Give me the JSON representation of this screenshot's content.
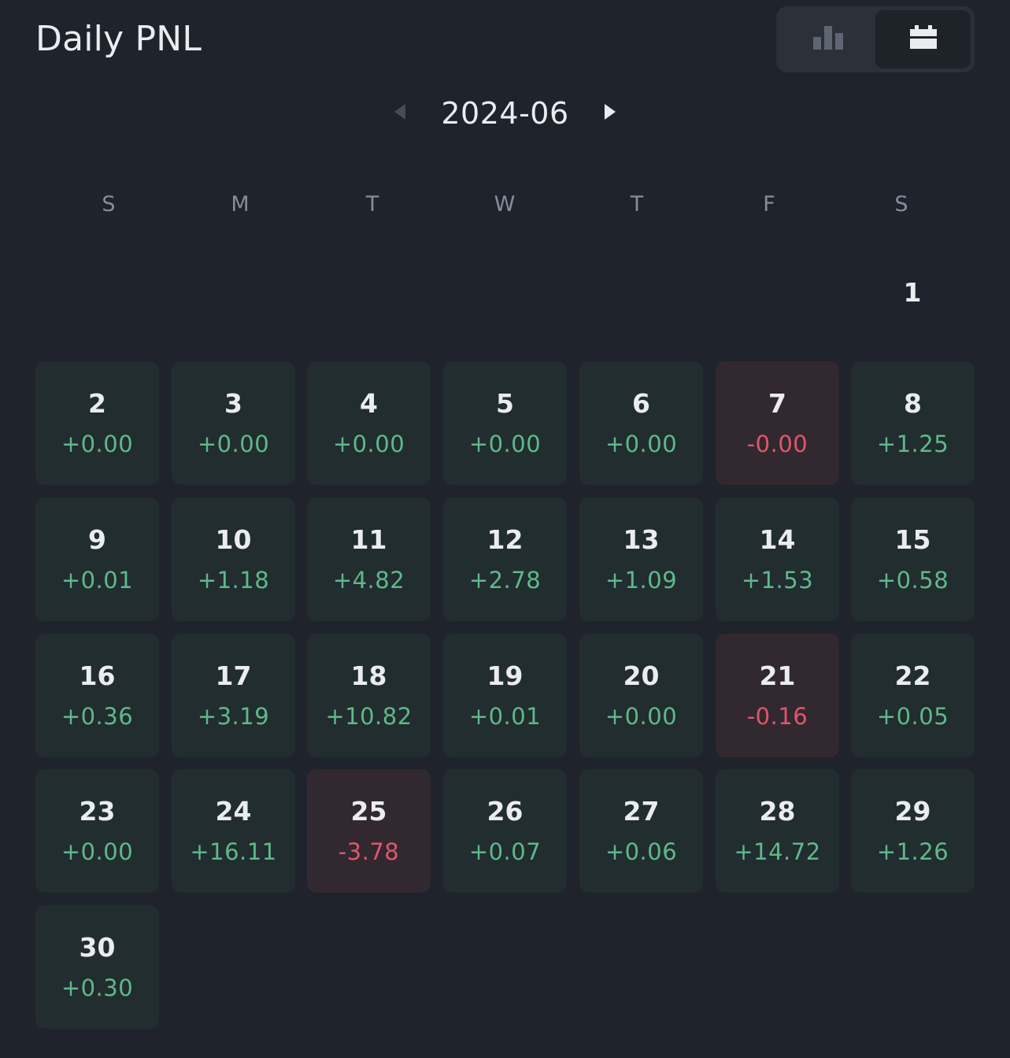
{
  "header": {
    "title": "Daily PNL"
  },
  "view_toggle": {
    "options": [
      {
        "icon": "bar-chart-icon",
        "active": false
      },
      {
        "icon": "calendar-icon",
        "active": true
      }
    ]
  },
  "month_nav": {
    "label": "2024-06",
    "prev_icon": "caret-left-icon",
    "next_icon": "caret-right-icon"
  },
  "weekdays": [
    "S",
    "M",
    "T",
    "W",
    "T",
    "F",
    "S"
  ],
  "first_day": "1",
  "colors": {
    "positive": "#5fb88a",
    "negative": "#e0566a",
    "background": "#1f232b"
  },
  "days": [
    {
      "day": "2",
      "pnl": "+0.00",
      "negative": false
    },
    {
      "day": "3",
      "pnl": "+0.00",
      "negative": false
    },
    {
      "day": "4",
      "pnl": "+0.00",
      "negative": false
    },
    {
      "day": "5",
      "pnl": "+0.00",
      "negative": false
    },
    {
      "day": "6",
      "pnl": "+0.00",
      "negative": false
    },
    {
      "day": "7",
      "pnl": "-0.00",
      "negative": true
    },
    {
      "day": "8",
      "pnl": "+1.25",
      "negative": false
    },
    {
      "day": "9",
      "pnl": "+0.01",
      "negative": false
    },
    {
      "day": "10",
      "pnl": "+1.18",
      "negative": false
    },
    {
      "day": "11",
      "pnl": "+4.82",
      "negative": false
    },
    {
      "day": "12",
      "pnl": "+2.78",
      "negative": false
    },
    {
      "day": "13",
      "pnl": "+1.09",
      "negative": false
    },
    {
      "day": "14",
      "pnl": "+1.53",
      "negative": false
    },
    {
      "day": "15",
      "pnl": "+0.58",
      "negative": false
    },
    {
      "day": "16",
      "pnl": "+0.36",
      "negative": false
    },
    {
      "day": "17",
      "pnl": "+3.19",
      "negative": false
    },
    {
      "day": "18",
      "pnl": "+10.82",
      "negative": false
    },
    {
      "day": "19",
      "pnl": "+0.01",
      "negative": false
    },
    {
      "day": "20",
      "pnl": "+0.00",
      "negative": false
    },
    {
      "day": "21",
      "pnl": "-0.16",
      "negative": true
    },
    {
      "day": "22",
      "pnl": "+0.05",
      "negative": false
    },
    {
      "day": "23",
      "pnl": "+0.00",
      "negative": false
    },
    {
      "day": "24",
      "pnl": "+16.11",
      "negative": false
    },
    {
      "day": "25",
      "pnl": "-3.78",
      "negative": true
    },
    {
      "day": "26",
      "pnl": "+0.07",
      "negative": false
    },
    {
      "day": "27",
      "pnl": "+0.06",
      "negative": false
    },
    {
      "day": "28",
      "pnl": "+14.72",
      "negative": false
    },
    {
      "day": "29",
      "pnl": "+1.26",
      "negative": false
    },
    {
      "day": "30",
      "pnl": "+0.30",
      "negative": false
    }
  ]
}
